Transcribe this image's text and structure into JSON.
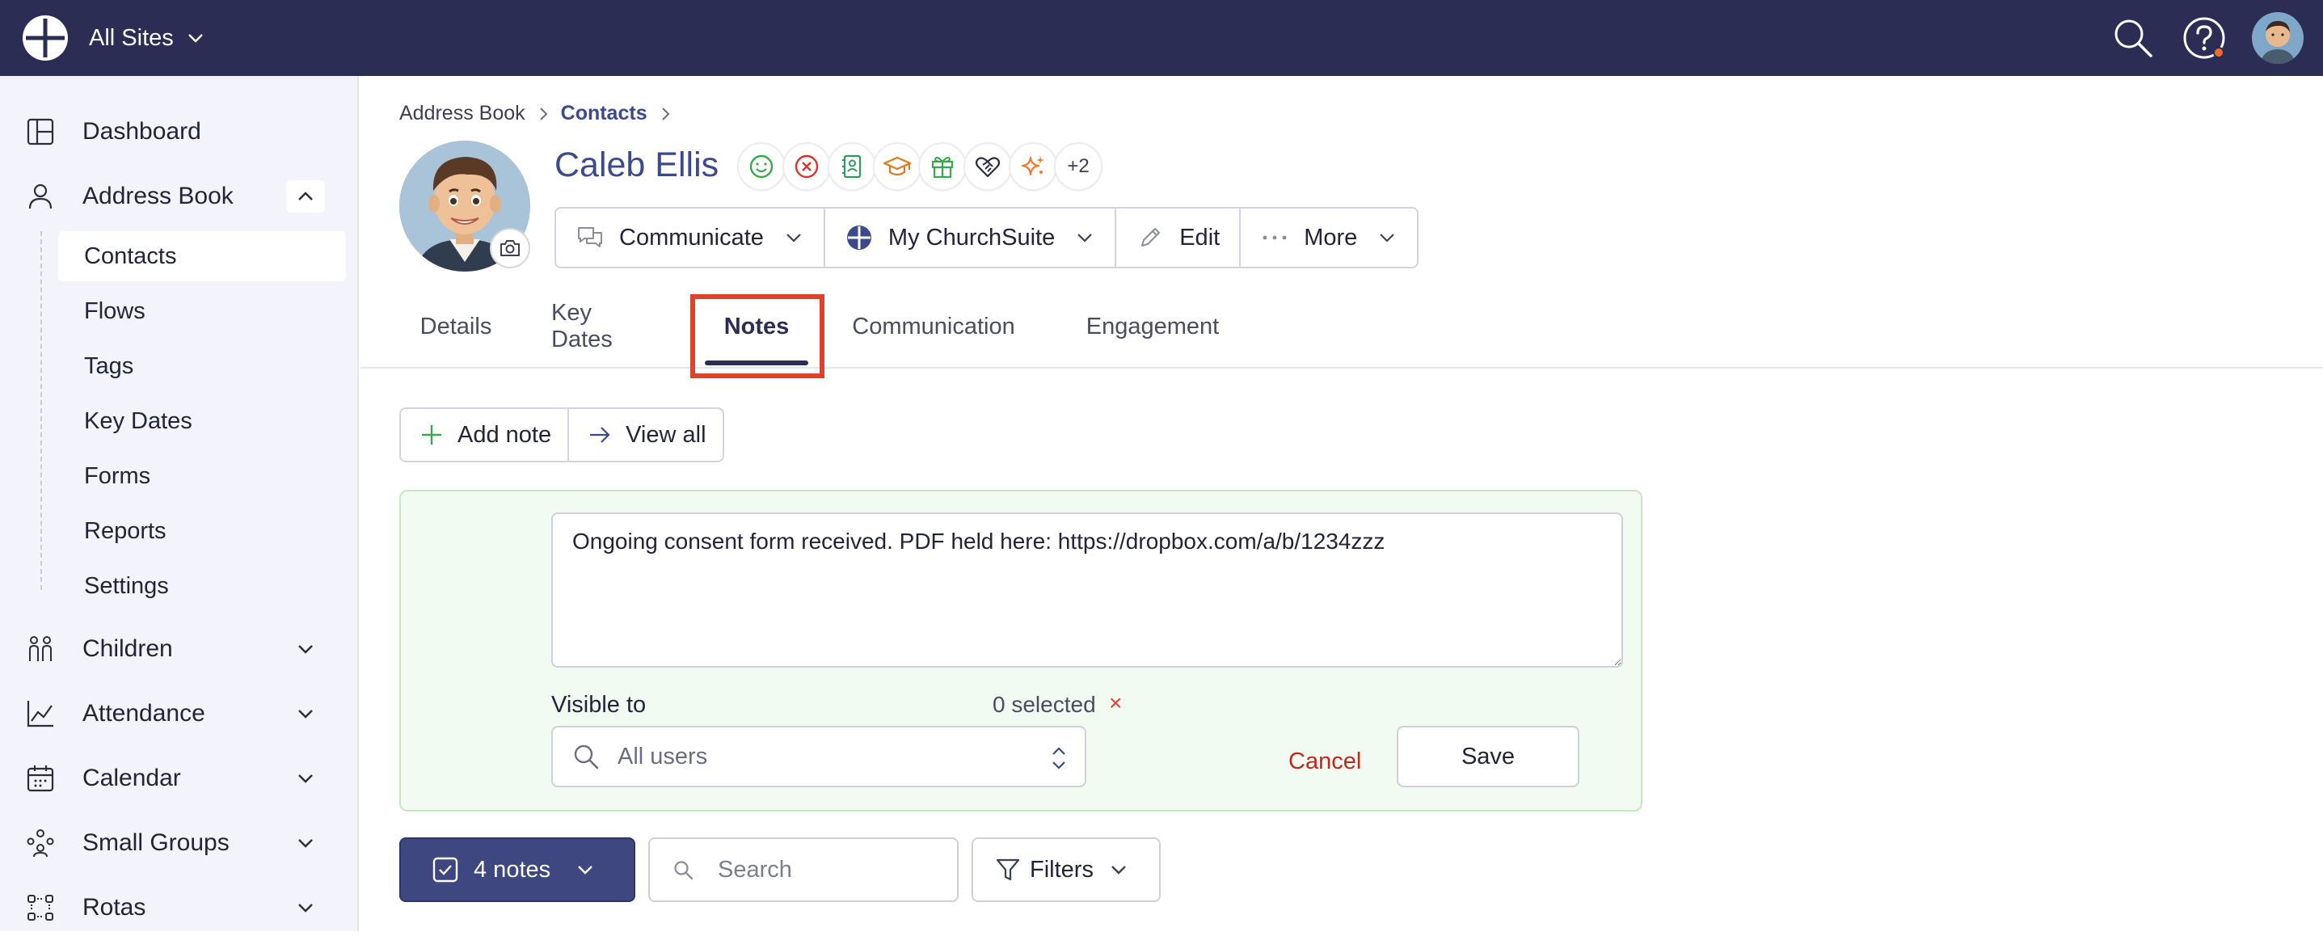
{
  "topbar": {
    "site_name": "All Sites",
    "icons": [
      "churchsuite-logo-icon",
      "search-icon",
      "help-icon",
      "user-avatar"
    ],
    "colors": {
      "background": "#2b2d55",
      "notification_dot": "#f26a2e"
    }
  },
  "sidebar": {
    "items": [
      {
        "label": "Dashboard",
        "icon": "dashboard-icon"
      },
      {
        "label": "Address Book",
        "icon": "person-icon",
        "expanded": true
      },
      {
        "label": "Children",
        "icon": "children-icon"
      },
      {
        "label": "Attendance",
        "icon": "chart-icon"
      },
      {
        "label": "Calendar",
        "icon": "calendar-icon"
      },
      {
        "label": "Small Groups",
        "icon": "group-icon"
      },
      {
        "label": "Rotas",
        "icon": "rota-icon"
      }
    ],
    "sub_items": [
      "Contacts",
      "Flows",
      "Tags",
      "Key Dates",
      "Forms",
      "Reports",
      "Settings"
    ],
    "active_sub": "Contacts"
  },
  "breadcrumb": {
    "root": "Address Book",
    "current": "Contacts"
  },
  "contact": {
    "name": "Caleb Ellis",
    "tag_icons": [
      "smile-icon",
      "cross-circle-icon",
      "contact-card-icon",
      "graduation-cap-icon",
      "gift-icon",
      "handshake-heart-icon",
      "sparkles-icon"
    ],
    "tag_more": "+2"
  },
  "actions": {
    "communicate": "Communicate",
    "my_churchsuite": "My ChurchSuite",
    "edit": "Edit",
    "more": "More"
  },
  "tabs": [
    "Details",
    "Key Dates",
    "Notes",
    "Communication",
    "Engagement"
  ],
  "active_tab": "Notes",
  "notes_toolbar": {
    "add_note": "Add note",
    "view_all": "View all"
  },
  "note_form": {
    "text": "Ongoing consent form received. PDF held here: https://dropbox.com/a/b/1234zzz",
    "visible_to_label": "Visible to",
    "selected_count": "0 selected",
    "clear_symbol": "×",
    "visible_to_value": "All users",
    "cancel": "Cancel",
    "save": "Save"
  },
  "notes_list": {
    "count_label": "4 notes",
    "search_placeholder": "Search",
    "filters": "Filters"
  },
  "colors": {
    "accent": "#3c4a8c",
    "highlight_box": "#e0412a",
    "form_background": "#f2fbf1",
    "cancel": "#c0271d"
  }
}
